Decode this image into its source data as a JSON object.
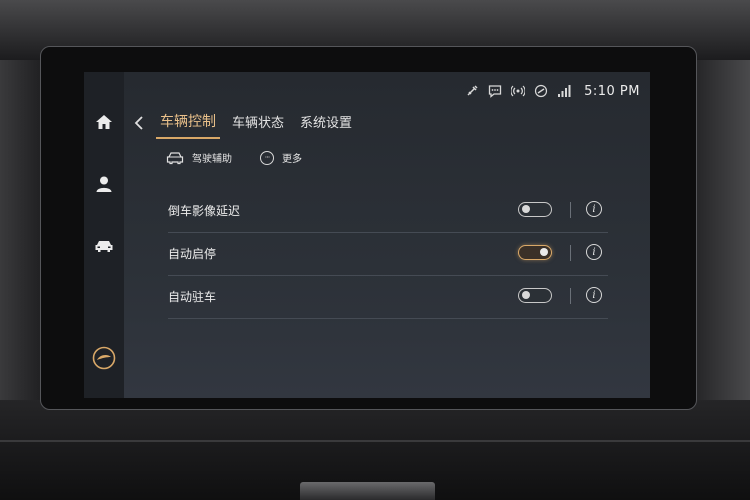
{
  "status_bar": {
    "time": "5:10 PM",
    "icons": [
      "usb-icon",
      "message-icon",
      "signal-broadcast-icon",
      "connected-icon",
      "cellular-signal-icon"
    ]
  },
  "sidebar": {
    "items": [
      {
        "icon": "home-icon"
      },
      {
        "icon": "user-icon"
      },
      {
        "icon": "car-icon"
      },
      {
        "icon": "brand-logo-icon"
      }
    ]
  },
  "tabs": [
    {
      "label": "车辆控制",
      "active": true
    },
    {
      "label": "车辆状态",
      "active": false
    },
    {
      "label": "系统设置",
      "active": false
    }
  ],
  "subnav": {
    "driving_assist": "驾驶辅助",
    "more": "更多"
  },
  "settings": [
    {
      "label": "倒车影像延迟",
      "enabled": false
    },
    {
      "label": "自动启停",
      "enabled": true
    },
    {
      "label": "自动驻车",
      "enabled": false
    }
  ],
  "colors": {
    "accent": "#d9a868",
    "active_tab_text": "#e9c08a"
  }
}
